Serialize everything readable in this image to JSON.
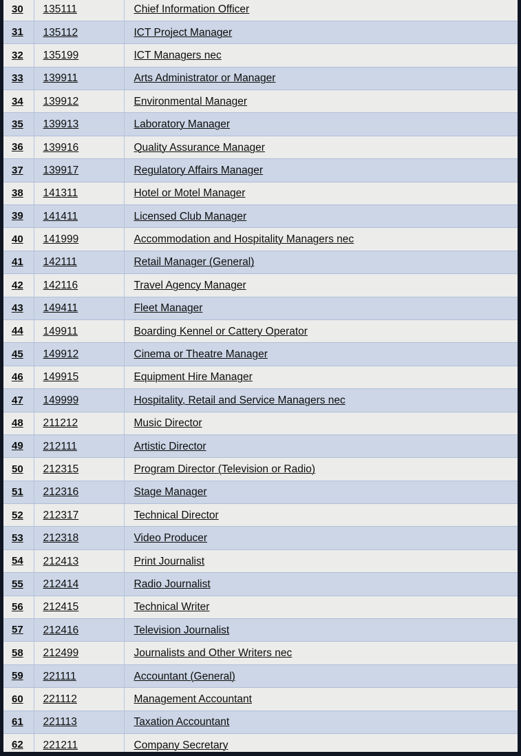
{
  "table": {
    "columns": [
      "row_number",
      "anzsco_code",
      "occupation_title"
    ],
    "rows": [
      {
        "n": "30",
        "code": "135111",
        "title": "Chief Information Officer"
      },
      {
        "n": "31",
        "code": "135112",
        "title": "ICT Project Manager"
      },
      {
        "n": "32",
        "code": "135199",
        "title": "ICT Managers nec"
      },
      {
        "n": "33",
        "code": "139911",
        "title": "Arts Administrator or Manager"
      },
      {
        "n": "34",
        "code": "139912",
        "title": "Environmental Manager"
      },
      {
        "n": "35",
        "code": "139913",
        "title": "Laboratory Manager"
      },
      {
        "n": "36",
        "code": "139916",
        "title": "Quality Assurance Manager"
      },
      {
        "n": "37",
        "code": "139917",
        "title": "Regulatory Affairs Manager"
      },
      {
        "n": "38",
        "code": "141311",
        "title": "Hotel or Motel Manager"
      },
      {
        "n": "39",
        "code": "141411",
        "title": "Licensed Club Manager"
      },
      {
        "n": "40",
        "code": "141999",
        "title": "Accommodation and Hospitality Managers nec"
      },
      {
        "n": "41",
        "code": "142111",
        "title": "Retail Manager (General)"
      },
      {
        "n": "42",
        "code": "142116",
        "title": "Travel Agency Manager"
      },
      {
        "n": "43",
        "code": "149411",
        "title": "Fleet Manager"
      },
      {
        "n": "44",
        "code": "149911",
        "title": "Boarding Kennel or Cattery Operator"
      },
      {
        "n": "45",
        "code": "149912",
        "title": "Cinema or Theatre Manager"
      },
      {
        "n": "46",
        "code": "149915",
        "title": "Equipment Hire Manager"
      },
      {
        "n": "47",
        "code": "149999",
        "title": "Hospitality, Retail and Service Managers nec"
      },
      {
        "n": "48",
        "code": "211212",
        "title": "Music Director"
      },
      {
        "n": "49",
        "code": "212111",
        "title": "Artistic Director"
      },
      {
        "n": "50",
        "code": "212315",
        "title": "Program Director (Television or Radio)"
      },
      {
        "n": "51",
        "code": "212316",
        "title": "Stage Manager"
      },
      {
        "n": "52",
        "code": "212317",
        "title": "Technical Director"
      },
      {
        "n": "53",
        "code": "212318",
        "title": "Video Producer"
      },
      {
        "n": "54",
        "code": "212413",
        "title": "Print Journalist"
      },
      {
        "n": "55",
        "code": "212414",
        "title": "Radio Journalist"
      },
      {
        "n": "56",
        "code": "212415",
        "title": "Technical Writer"
      },
      {
        "n": "57",
        "code": "212416",
        "title": "Television Journalist"
      },
      {
        "n": "58",
        "code": "212499",
        "title": "Journalists and Other Writers nec"
      },
      {
        "n": "59",
        "code": "221111",
        "title": "Accountant (General)"
      },
      {
        "n": "60",
        "code": "221112",
        "title": "Management Accountant"
      },
      {
        "n": "61",
        "code": "221113",
        "title": "Taxation Accountant"
      },
      {
        "n": "62",
        "code": "221211",
        "title": "Company Secretary"
      }
    ]
  },
  "theme": {
    "row_odd_bg": "#ececeb",
    "row_even_bg": "#ccd6e6",
    "grid_line": "#b0bed8",
    "frame": "#101522",
    "text": "#0d0d0d"
  }
}
